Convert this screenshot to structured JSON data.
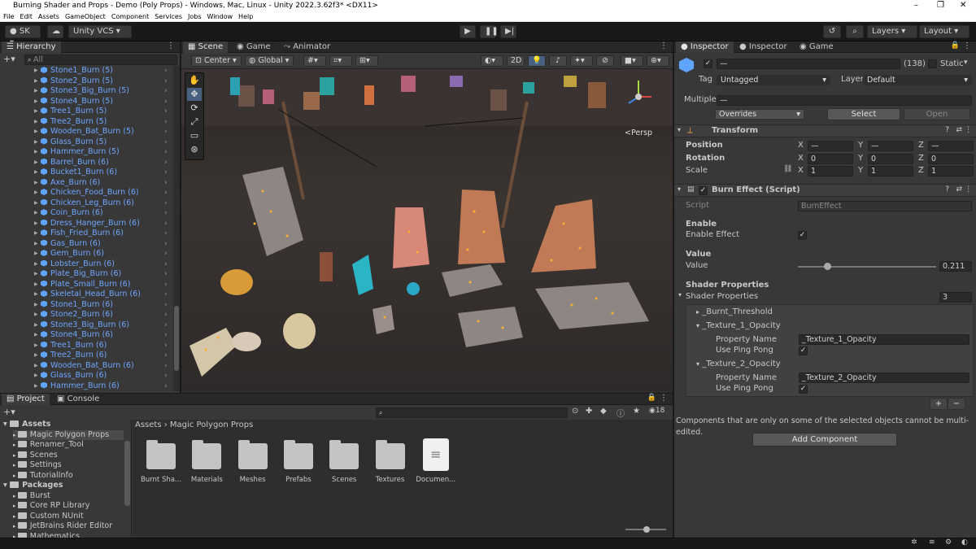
{
  "window": {
    "title": "Burning Shader and Props - Demo (Poly Props) - Windows, Mac, Linux - Unity 2022.3.62f3* <DX11>"
  },
  "menu": [
    "File",
    "Edit",
    "Assets",
    "GameObject",
    "Component",
    "Services",
    "Jobs",
    "Window",
    "Help"
  ],
  "toolbar": {
    "account": "SK",
    "vcs": "Unity VCS",
    "layers": "Layers",
    "layout": "Layout"
  },
  "hierarchy": {
    "title": "Hierarchy",
    "search_placeholder": "All",
    "items": [
      "Stone1_Burn (5)",
      "Stone2_Burn (5)",
      "Stone3_Big_Burn (5)",
      "Stone4_Burn (5)",
      "Tree1_Burn (5)",
      "Tree2_Burn (5)",
      "Wooden_Bat_Burn (5)",
      "Glass_Burn (5)",
      "Hammer_Burn (5)",
      "Barrel_Burn (6)",
      "Bucket1_Burn (6)",
      "Axe_Burn (6)",
      "Chicken_Food_Burn (6)",
      "Chicken_Leg_Burn (6)",
      "Coin_Burn (6)",
      "Dress_Hanger_Burn (6)",
      "Fish_Fried_Burn (6)",
      "Gas_Burn (6)",
      "Gem_Burn (6)",
      "Lobster_Burn (6)",
      "Plate_Big_Burn (6)",
      "Plate_Small_Burn (6)",
      "Skeletal_Head_Burn (6)",
      "Stone1_Burn (6)",
      "Stone2_Burn (6)",
      "Stone3_Big_Burn (6)",
      "Stone4_Burn (6)",
      "Tree1_Burn (6)",
      "Tree2_Burn (6)",
      "Wooden_Bat_Burn (6)",
      "Glass_Burn (6)",
      "Hammer_Burn (6)"
    ]
  },
  "scene": {
    "tabs": [
      "Scene",
      "Game",
      "Animator"
    ],
    "pivot": "Center",
    "space": "Global",
    "mode2d": "2D",
    "persp": "<Persp"
  },
  "project": {
    "tabs": [
      "Project",
      "Console"
    ],
    "tree": {
      "assets": "Assets",
      "asset_children": [
        "Magic Polygon Props",
        "Renamer_Tool",
        "Scenes",
        "Settings",
        "TutorialInfo"
      ],
      "packages": "Packages",
      "package_children": [
        "Burst",
        "Core RP Library",
        "Custom NUnit",
        "JetBrains Rider Editor",
        "Mathematics"
      ]
    },
    "breadcrumb": [
      "Assets",
      "Magic Polygon Props"
    ],
    "items": [
      "Burnt Sha...",
      "Materials",
      "Meshes",
      "Prefabs",
      "Scenes",
      "Textures",
      "Documen..."
    ],
    "count": "18"
  },
  "inspector": {
    "tabs": [
      "Inspector",
      "Inspector",
      "Game"
    ],
    "object": {
      "name": "—",
      "count": "(138)",
      "static": "Static",
      "tag_label": "Tag",
      "tag": "Untagged",
      "layer_label": "Layer",
      "layer": "Default",
      "multiple_label": "Multiple",
      "multiple": "—",
      "overrides": "Overrides",
      "select": "Select",
      "open": "Open"
    },
    "transform": {
      "title": "Transform",
      "position": "Position",
      "rotation": "Rotation",
      "scale": "Scale",
      "pos": [
        "—",
        "—",
        "—"
      ],
      "rot": [
        "0",
        "0",
        "0"
      ],
      "scl": [
        "1",
        "1",
        "1"
      ]
    },
    "burn": {
      "title": "Burn Effect (Script)",
      "script_label": "Script",
      "script": "BurnEffect",
      "enable_header": "Enable",
      "enable_label": "Enable Effect",
      "value_header": "Value",
      "value_label": "Value",
      "value": "0.211",
      "value_fraction": 0.211,
      "shader_header": "Shader Properties",
      "shader_label": "Shader Properties",
      "shader_count": "3",
      "props": [
        {
          "name": "_Burnt_Threshold"
        },
        {
          "name": "_Texture_1_Opacity",
          "pn_label": "Property Name",
          "pn": "_Texture_1_Opacity",
          "pp_label": "Use Ping Pong"
        },
        {
          "name": "_Texture_2_Opacity",
          "pn_label": "Property Name",
          "pn": "_Texture_2_Opacity",
          "pp_label": "Use Ping Pong"
        }
      ]
    },
    "note": "Components that are only on some of the selected objects cannot be multi-edited.",
    "add_component": "Add Component"
  }
}
